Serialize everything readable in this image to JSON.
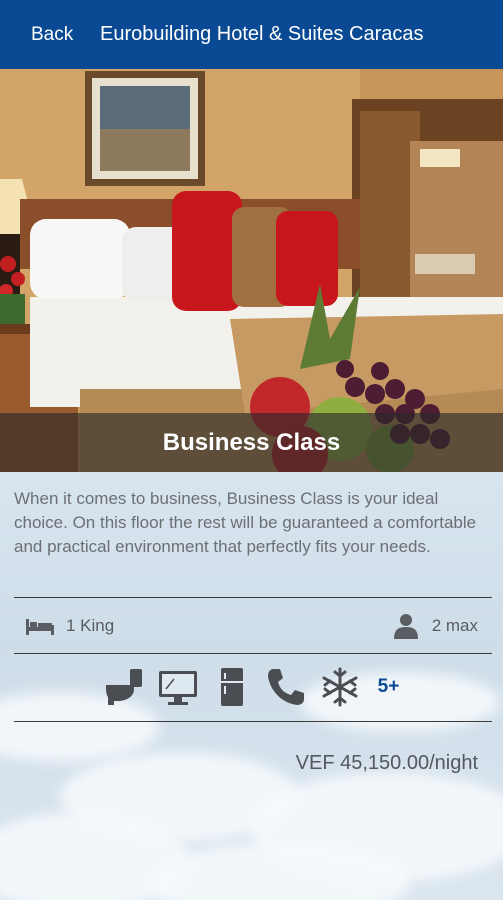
{
  "nav": {
    "back_label": "Back",
    "title": "Eurobuilding Hotel & Suites Caracas",
    "color": "#0a4a94"
  },
  "room": {
    "name": "Business Class",
    "description": "When it comes to business, Business Class is your ideal choice. On this floor the rest will be guaranteed a comfortable and practical environment that perfectly fits your needs.",
    "bed": "1 King",
    "max_guests": "2 max",
    "price": "VEF 45,150.00/night"
  },
  "amenities": {
    "icons": [
      "bathroom-icon",
      "monitor-icon",
      "fridge-icon",
      "phone-icon",
      "snowflake-icon"
    ],
    "more_label": "5+"
  }
}
